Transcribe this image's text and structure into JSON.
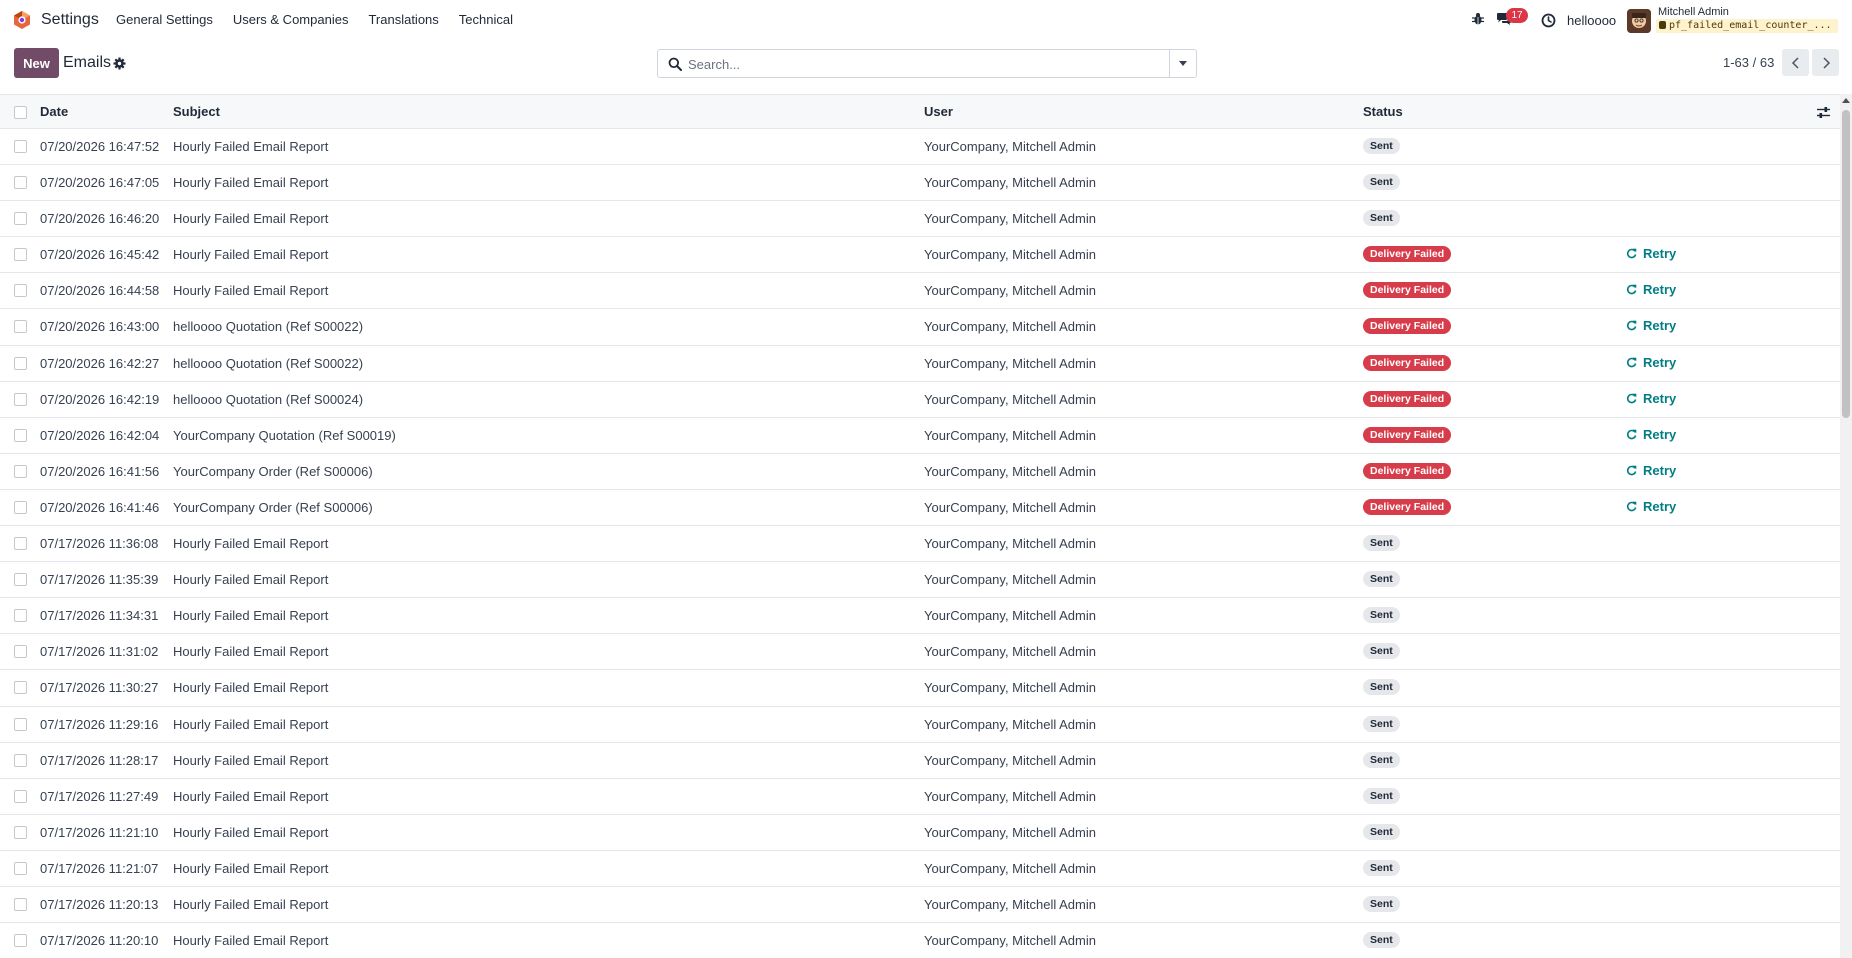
{
  "navbar": {
    "app_name": "Settings",
    "menu": [
      "General Settings",
      "Users & Companies",
      "Translations",
      "Technical"
    ],
    "chat_count": "17",
    "company": "helloooo",
    "user_name": "Mitchell Admin",
    "db_name": "pf_failed_email_counter_..."
  },
  "control": {
    "new_label": "New",
    "breadcrumb": "Emails",
    "search_placeholder": "Search...",
    "pager": "1-63 / 63"
  },
  "table": {
    "columns": [
      "Date",
      "Subject",
      "User",
      "Status"
    ],
    "retry_label": "Retry",
    "rows": [
      {
        "date": "07/20/2026 16:47:52",
        "subject": "Hourly Failed Email Report",
        "user": "YourCompany, Mitchell Admin",
        "status": "Sent",
        "failed": false
      },
      {
        "date": "07/20/2026 16:47:05",
        "subject": "Hourly Failed Email Report",
        "user": "YourCompany, Mitchell Admin",
        "status": "Sent",
        "failed": false
      },
      {
        "date": "07/20/2026 16:46:20",
        "subject": "Hourly Failed Email Report",
        "user": "YourCompany, Mitchell Admin",
        "status": "Sent",
        "failed": false
      },
      {
        "date": "07/20/2026 16:45:42",
        "subject": "Hourly Failed Email Report",
        "user": "YourCompany, Mitchell Admin",
        "status": "Delivery Failed",
        "failed": true
      },
      {
        "date": "07/20/2026 16:44:58",
        "subject": "Hourly Failed Email Report",
        "user": "YourCompany, Mitchell Admin",
        "status": "Delivery Failed",
        "failed": true
      },
      {
        "date": "07/20/2026 16:43:00",
        "subject": "helloooo Quotation (Ref S00022)",
        "user": "YourCompany, Mitchell Admin",
        "status": "Delivery Failed",
        "failed": true
      },
      {
        "date": "07/20/2026 16:42:27",
        "subject": "helloooo Quotation (Ref S00022)",
        "user": "YourCompany, Mitchell Admin",
        "status": "Delivery Failed",
        "failed": true
      },
      {
        "date": "07/20/2026 16:42:19",
        "subject": "helloooo Quotation (Ref S00024)",
        "user": "YourCompany, Mitchell Admin",
        "status": "Delivery Failed",
        "failed": true
      },
      {
        "date": "07/20/2026 16:42:04",
        "subject": "YourCompany Quotation (Ref S00019)",
        "user": "YourCompany, Mitchell Admin",
        "status": "Delivery Failed",
        "failed": true
      },
      {
        "date": "07/20/2026 16:41:56",
        "subject": "YourCompany Order (Ref S00006)",
        "user": "YourCompany, Mitchell Admin",
        "status": "Delivery Failed",
        "failed": true
      },
      {
        "date": "07/20/2026 16:41:46",
        "subject": "YourCompany Order (Ref S00006)",
        "user": "YourCompany, Mitchell Admin",
        "status": "Delivery Failed",
        "failed": true
      },
      {
        "date": "07/17/2026 11:36:08",
        "subject": "Hourly Failed Email Report",
        "user": "YourCompany, Mitchell Admin",
        "status": "Sent",
        "failed": false
      },
      {
        "date": "07/17/2026 11:35:39",
        "subject": "Hourly Failed Email Report",
        "user": "YourCompany, Mitchell Admin",
        "status": "Sent",
        "failed": false
      },
      {
        "date": "07/17/2026 11:34:31",
        "subject": "Hourly Failed Email Report",
        "user": "YourCompany, Mitchell Admin",
        "status": "Sent",
        "failed": false
      },
      {
        "date": "07/17/2026 11:31:02",
        "subject": "Hourly Failed Email Report",
        "user": "YourCompany, Mitchell Admin",
        "status": "Sent",
        "failed": false
      },
      {
        "date": "07/17/2026 11:30:27",
        "subject": "Hourly Failed Email Report",
        "user": "YourCompany, Mitchell Admin",
        "status": "Sent",
        "failed": false
      },
      {
        "date": "07/17/2026 11:29:16",
        "subject": "Hourly Failed Email Report",
        "user": "YourCompany, Mitchell Admin",
        "status": "Sent",
        "failed": false
      },
      {
        "date": "07/17/2026 11:28:17",
        "subject": "Hourly Failed Email Report",
        "user": "YourCompany, Mitchell Admin",
        "status": "Sent",
        "failed": false
      },
      {
        "date": "07/17/2026 11:27:49",
        "subject": "Hourly Failed Email Report",
        "user": "YourCompany, Mitchell Admin",
        "status": "Sent",
        "failed": false
      },
      {
        "date": "07/17/2026 11:21:10",
        "subject": "Hourly Failed Email Report",
        "user": "YourCompany, Mitchell Admin",
        "status": "Sent",
        "failed": false
      },
      {
        "date": "07/17/2026 11:21:07",
        "subject": "Hourly Failed Email Report",
        "user": "YourCompany, Mitchell Admin",
        "status": "Sent",
        "failed": false
      },
      {
        "date": "07/17/2026 11:20:13",
        "subject": "Hourly Failed Email Report",
        "user": "YourCompany, Mitchell Admin",
        "status": "Sent",
        "failed": false
      },
      {
        "date": "07/17/2026 11:20:10",
        "subject": "Hourly Failed Email Report",
        "user": "YourCompany, Mitchell Admin",
        "status": "Sent",
        "failed": false
      }
    ]
  },
  "colors": {
    "primary": "#714b67",
    "failed": "#d63c4a",
    "retry": "#017e84"
  }
}
